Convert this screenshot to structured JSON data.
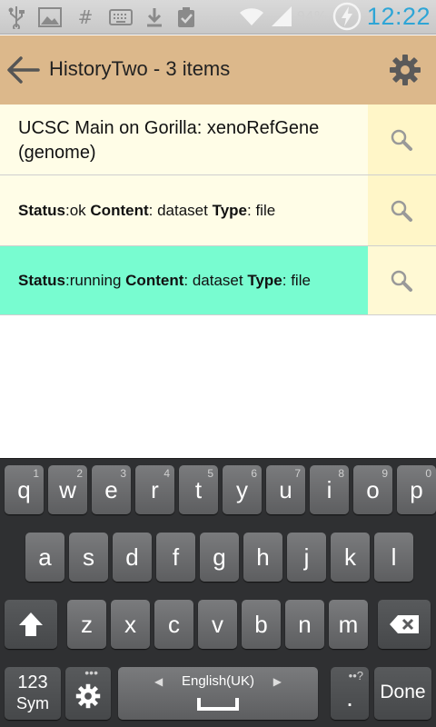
{
  "status_bar": {
    "icons": [
      "usb-icon",
      "image-icon",
      "hash-icon",
      "keyboard-icon",
      "download-icon",
      "clipboard-check-icon",
      "wifi-icon",
      "signal-icon",
      "battery-charging-icon"
    ],
    "battery_percent": "94%",
    "time": "12:22",
    "clock_color": "#2ea5d6"
  },
  "action_bar": {
    "title": "HistoryTwo - 3 items",
    "back_icon": "back-arrow-icon",
    "settings_icon": "gear-icon",
    "color": "#dcb88b"
  },
  "items": [
    {
      "title": "UCSC Main on Gorilla: xenoRefGene (genome)"
    },
    {
      "status_label": "Status",
      "status": "ok",
      "content_label": "Content",
      "content": "dataset",
      "type_label": "Type",
      "type": "file"
    },
    {
      "status_label": "Status",
      "status": "running",
      "content_label": "Content",
      "content": "dataset",
      "type_label": "Type",
      "type": "file",
      "highlight": "#78fcd0"
    }
  ],
  "keyboard": {
    "row1": [
      {
        "ch": "q",
        "num": "1"
      },
      {
        "ch": "w",
        "num": "2"
      },
      {
        "ch": "e",
        "num": "3"
      },
      {
        "ch": "r",
        "num": "4"
      },
      {
        "ch": "t",
        "num": "5"
      },
      {
        "ch": "y",
        "num": "6"
      },
      {
        "ch": "u",
        "num": "7"
      },
      {
        "ch": "i",
        "num": "8"
      },
      {
        "ch": "o",
        "num": "9"
      },
      {
        "ch": "p",
        "num": "0"
      }
    ],
    "row2": [
      "a",
      "s",
      "d",
      "f",
      "g",
      "h",
      "j",
      "k",
      "l"
    ],
    "row3": [
      "z",
      "x",
      "c",
      "v",
      "b",
      "n",
      "m"
    ],
    "sym_top": "123",
    "sym_bottom": "Sym",
    "language": "English(UK)",
    "period": ".",
    "done": "Done"
  }
}
